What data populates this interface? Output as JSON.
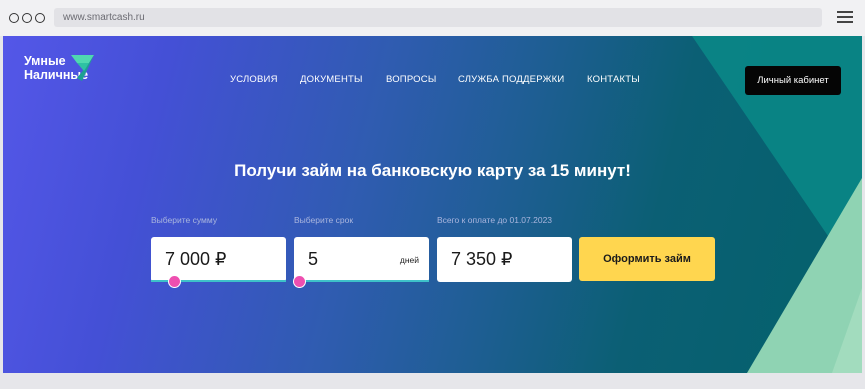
{
  "browser": {
    "url": "www.smartcash.ru"
  },
  "logo": {
    "line1": "Умные",
    "line2": "Наличные"
  },
  "nav": {
    "items": [
      "УСЛОВИЯ",
      "ДОКУМЕНТЫ",
      "ВОПРОСЫ",
      "СЛУЖБА ПОДДЕРЖКИ",
      "КОНТАКТЫ"
    ]
  },
  "cabinet_label": "Личный кабинет",
  "headline": "Получи займ на банковскую карту за 15 минут!",
  "calculator": {
    "amount_label": "Выберите сумму",
    "amount_value": "7 000 ₽",
    "term_label": "Выберите срок",
    "term_value": "5",
    "term_unit": "дней",
    "total_label": "Всего к оплате до 01.07.2023",
    "total_value": "7 350 ₽",
    "submit_label": "Оформить займ"
  },
  "colors": {
    "accent_yellow": "#ffd64f",
    "slider_knob": "#ee4fb0",
    "slider_track": "#3ec1c9",
    "cabinet_bg": "#050505"
  }
}
